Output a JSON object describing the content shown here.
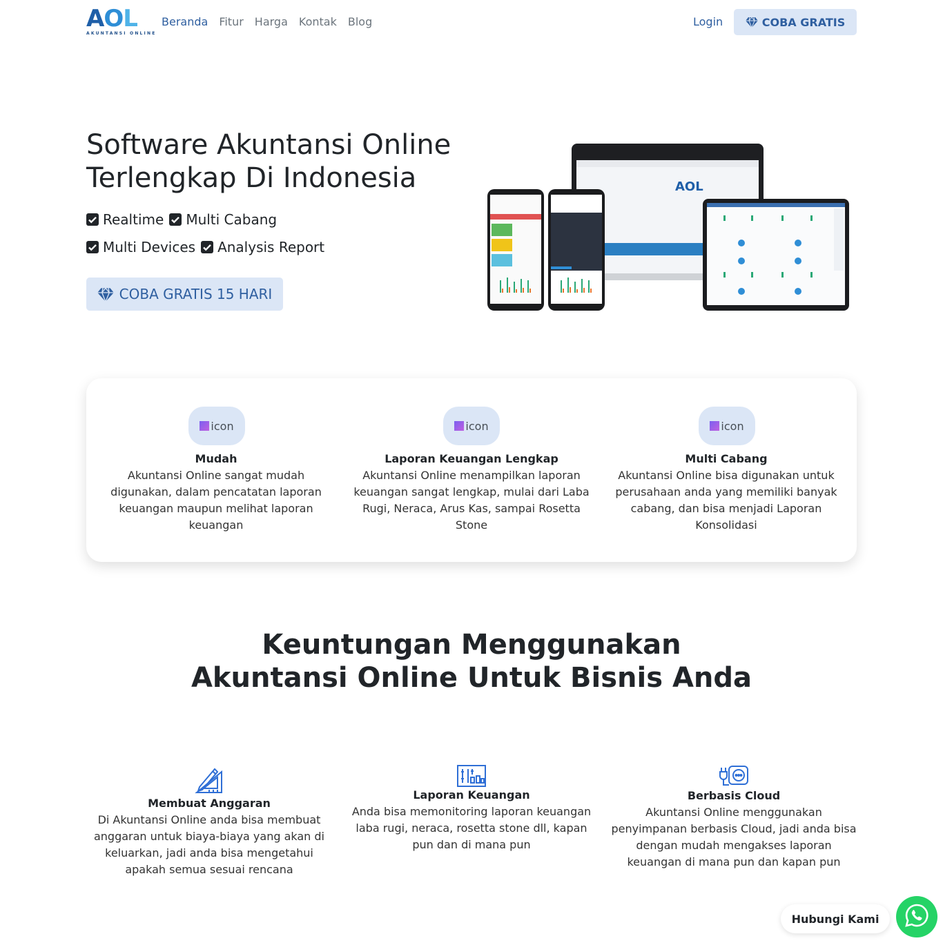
{
  "navbar": {
    "logo_mark": "AOL",
    "logo_subtitle": "AKUNTANSI ONLINE",
    "links": [
      {
        "label": "Beranda",
        "active": true
      },
      {
        "label": "Fitur",
        "active": false
      },
      {
        "label": "Harga",
        "active": false
      },
      {
        "label": "Kontak",
        "active": false
      },
      {
        "label": "Blog",
        "active": false
      }
    ],
    "login_label": "Login",
    "cta_label": "COBA GRATIS",
    "cta_icon": "diamond-icon"
  },
  "hero": {
    "title_line1": "Software Akuntansi Online",
    "title_line2": "Terlengkap Di Indonesia",
    "features": [
      "Realtime",
      "Multi Cabang",
      "Multi Devices",
      "Analysis Report"
    ],
    "feature_icon": "checkbox-checked-icon",
    "cta_label": "COBA GRATIS 15 HARI",
    "device_logo": "AOL"
  },
  "highlights": [
    {
      "icon_alt": "icon",
      "title": "Mudah",
      "desc": "Akuntansi Online sangat mudah digunakan, dalam pencatatan laporan keuangan maupun melihat laporan keuangan"
    },
    {
      "icon_alt": "icon",
      "title": "Laporan Keuangan Lengkap",
      "desc": "Akuntansi Online menampilkan laporan keuangan sangat lengkap, mulai dari Laba Rugi, Neraca, Arus Kas, sampai Rosetta Stone"
    },
    {
      "icon_alt": "icon",
      "title": "Multi Cabang",
      "desc": "Akuntansi Online bisa digunakan untuk perusahaan anda yang memiliki banyak cabang, dan bisa menjadi Laporan Konsolidasi"
    }
  ],
  "benefits": {
    "title_line1": "Keuntungan Menggunakan",
    "title_line2": "Akuntansi Online Untuk Bisnis Anda",
    "items": [
      {
        "icon": "ruler-pencil-icon",
        "title": "Membuat Anggaran",
        "desc": "Di Akuntansi Online anda bisa membuat anggaran untuk biaya-biaya yang akan di keluarkan, jadi anda bisa mengetahui apakah semua sesuai rencana"
      },
      {
        "icon": "report-chart-icon",
        "title": "Laporan Keuangan",
        "desc": "Anda bisa memonitoring laporan keuangan laba rugi, neraca, rosetta stone dll, kapan pun dan di mana pun"
      },
      {
        "icon": "cloud-plug-icon",
        "title": "Berbasis Cloud",
        "desc": "Akuntansi Online menggunakan penyimpanan berbasis Cloud, jadi anda bisa dengan mudah mengakses laporan keuangan di mana pun dan kapan pun"
      }
    ]
  },
  "whatsapp": {
    "label": "Hubungi Kami",
    "icon": "whatsapp-icon"
  },
  "colors": {
    "accent": "#2f5fa0",
    "accent_bg": "#dbe6f6",
    "whatsapp": "#25d366"
  }
}
